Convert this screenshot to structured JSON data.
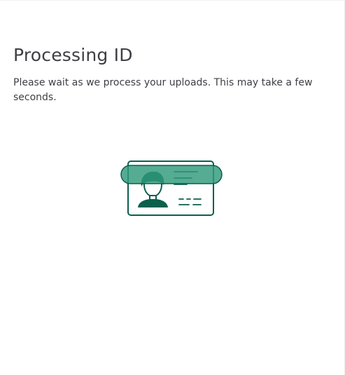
{
  "screen": {
    "title": "Processing ID",
    "message": "Please wait as we process your uploads. This may take a few seconds."
  },
  "illustration": {
    "icon": "id-card-scanning-icon",
    "colors": {
      "stroke": "#006e58",
      "scan_band": "#4fae93"
    }
  }
}
